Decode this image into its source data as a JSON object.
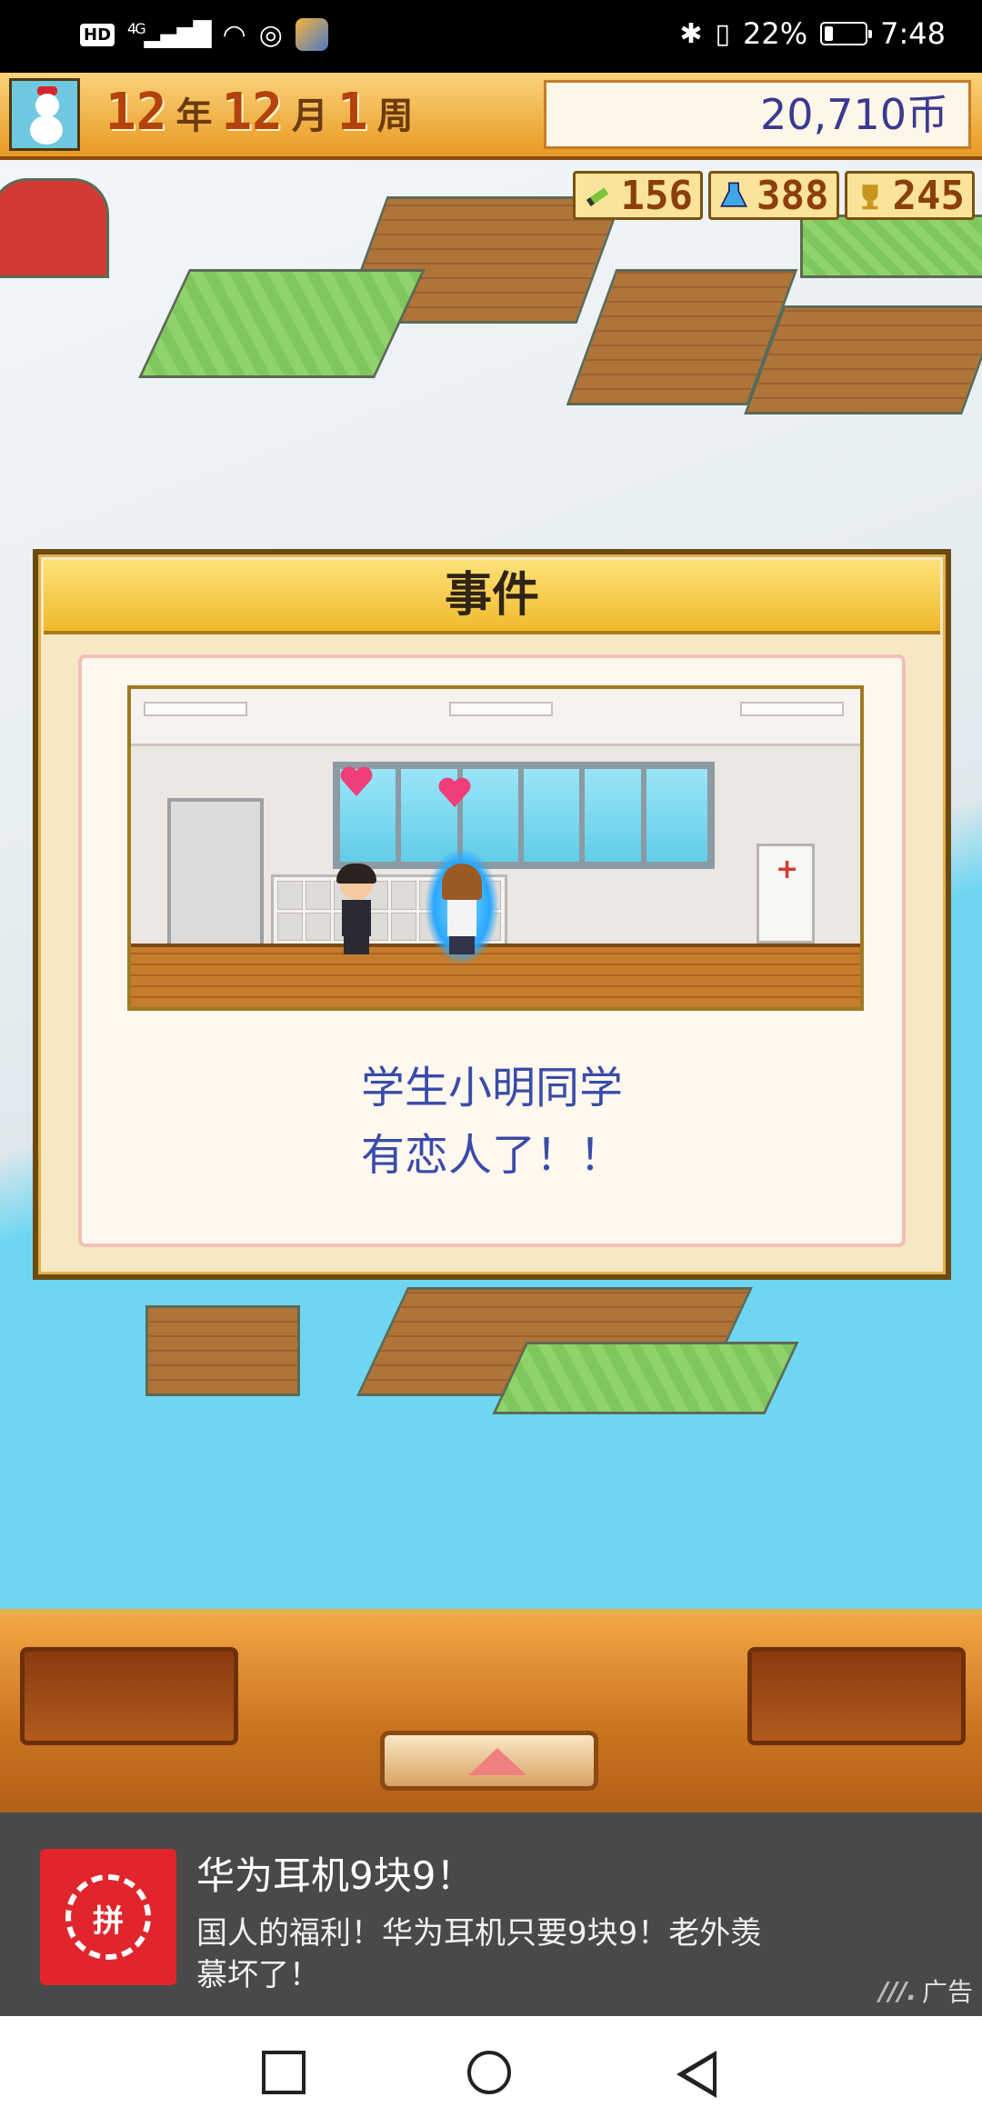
{
  "status_bar": {
    "hd": "HD",
    "network": "4G",
    "battery": "22%",
    "time": "7:48"
  },
  "header": {
    "year": "12",
    "year_unit": "年",
    "month": "12",
    "month_unit": "月",
    "week": "1",
    "week_unit": "周",
    "money": "20,710币"
  },
  "resources": [
    {
      "icon": "pencil-icon",
      "value": "156"
    },
    {
      "icon": "flask-icon",
      "value": "388"
    },
    {
      "icon": "trophy-icon",
      "value": "245"
    }
  ],
  "dialog": {
    "title": "事件",
    "message_line1": "学生小明同学",
    "message_line2": "有恋人了！！"
  },
  "ad": {
    "title": "华为耳机9块9！",
    "description": "国人的福利！华为耳机只要9块9！老外羡慕坏了！",
    "tag": "广告",
    "logo_text": "拼"
  },
  "colors": {
    "dialog_header": "#f0b92b",
    "message_text": "#3a4ba8",
    "money_text": "#3c3a8e",
    "ad_logo": "#e0262c"
  }
}
